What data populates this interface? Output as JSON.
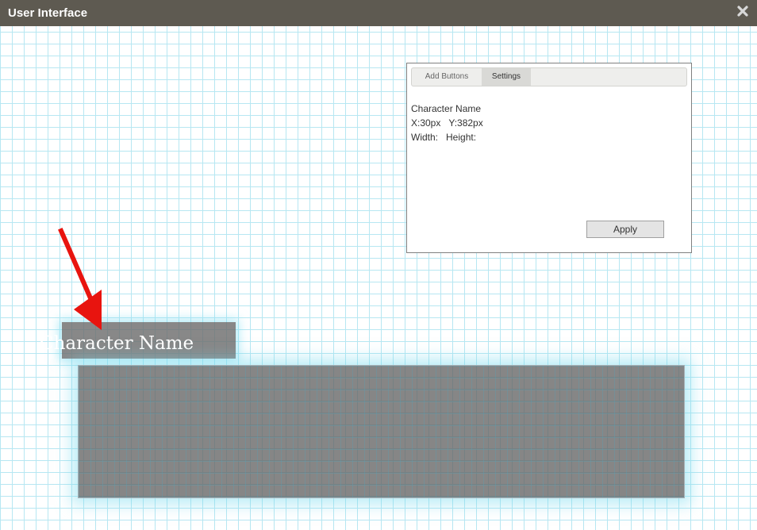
{
  "window": {
    "title": "User Interface",
    "close_icon": "close-icon"
  },
  "panel": {
    "tabs": [
      {
        "label": "Add Buttons",
        "active": false
      },
      {
        "label": "Settings",
        "active": true
      }
    ],
    "name": "Character Name",
    "x_label": "X:30px",
    "y_label": "Y:382px",
    "width_label": "Width:",
    "height_label": "Height:",
    "apply_label": "Apply"
  },
  "canvas": {
    "label_text": "Character Name",
    "annotation_icon": "red-arrow-icon"
  },
  "colors": {
    "titlebar": "#5e5a51",
    "grid": "#b7e7f2",
    "arrow": "#e8140f",
    "glow": "#78dcf0"
  }
}
